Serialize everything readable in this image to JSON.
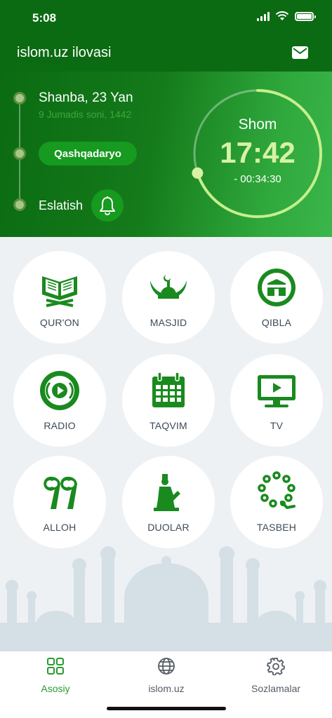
{
  "status_bar": {
    "time": "5:08"
  },
  "header": {
    "title": "islom.uz ilovasi",
    "mail_icon": "mail-icon"
  },
  "hero": {
    "date": "Shanba, 23 Yan",
    "hijri_date": "9 Jumadis soni, 1442",
    "region": "Qashqadaryo",
    "reminder_label": "Eslatish",
    "prayer_name": "Shom",
    "prayer_time": "17:42",
    "countdown": "- 00:34:30",
    "progress_fraction": 0.7
  },
  "grid": [
    {
      "label": "QUR'ON",
      "icon": "quran-icon"
    },
    {
      "label": "MASJID",
      "icon": "mosque-icon"
    },
    {
      "label": "QIBLA",
      "icon": "kaaba-icon"
    },
    {
      "label": "RADIO",
      "icon": "radio-icon"
    },
    {
      "label": "TAQVIM",
      "icon": "calendar-icon"
    },
    {
      "label": "TV",
      "icon": "tv-icon"
    },
    {
      "label": "ALLOH",
      "icon": "allah-icon"
    },
    {
      "label": "DUOLAR",
      "icon": "prayer-icon"
    },
    {
      "label": "TASBEH",
      "icon": "tasbeh-icon"
    }
  ],
  "bottom_nav": [
    {
      "label": "Asosiy",
      "icon": "grid-icon",
      "active": true
    },
    {
      "label": "islom.uz",
      "icon": "globe-icon",
      "active": false
    },
    {
      "label": "Sozlamalar",
      "icon": "gear-icon",
      "active": false
    }
  ],
  "colors": {
    "brand_green": "#0b6b12",
    "accent_green": "#169a1f",
    "icon_green": "#1a8a1f",
    "highlight": "#d8f2a4"
  }
}
